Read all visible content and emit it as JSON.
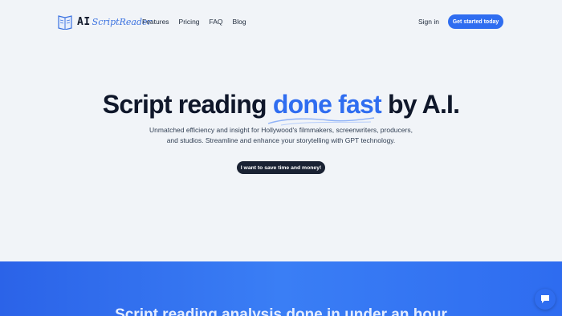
{
  "brand": {
    "prefix": "AI",
    "script": "ScriptReader"
  },
  "nav": {
    "items": [
      "Features",
      "Pricing",
      "FAQ",
      "Blog"
    ]
  },
  "header": {
    "signin": "Sign in",
    "cta": "Get started today"
  },
  "hero": {
    "title_pre": "Script reading ",
    "title_accent": "done fast",
    "title_post": " by A.I.",
    "subtitle": "Unmatched efficiency and insight for Hollywood's filmmakers, screenwriters, producers, and studios. Streamline and enhance your storytelling with GPT technology.",
    "cta": "I want to save time and money!"
  },
  "section2": {
    "title": "Script reading analysis done in under an hour"
  },
  "colors": {
    "accent": "#2f6df0",
    "dark_button": "#1a2233",
    "background": "#f1f4f8"
  },
  "icons": {
    "logo": "book-icon",
    "chat": "chat-bubble-icon"
  }
}
